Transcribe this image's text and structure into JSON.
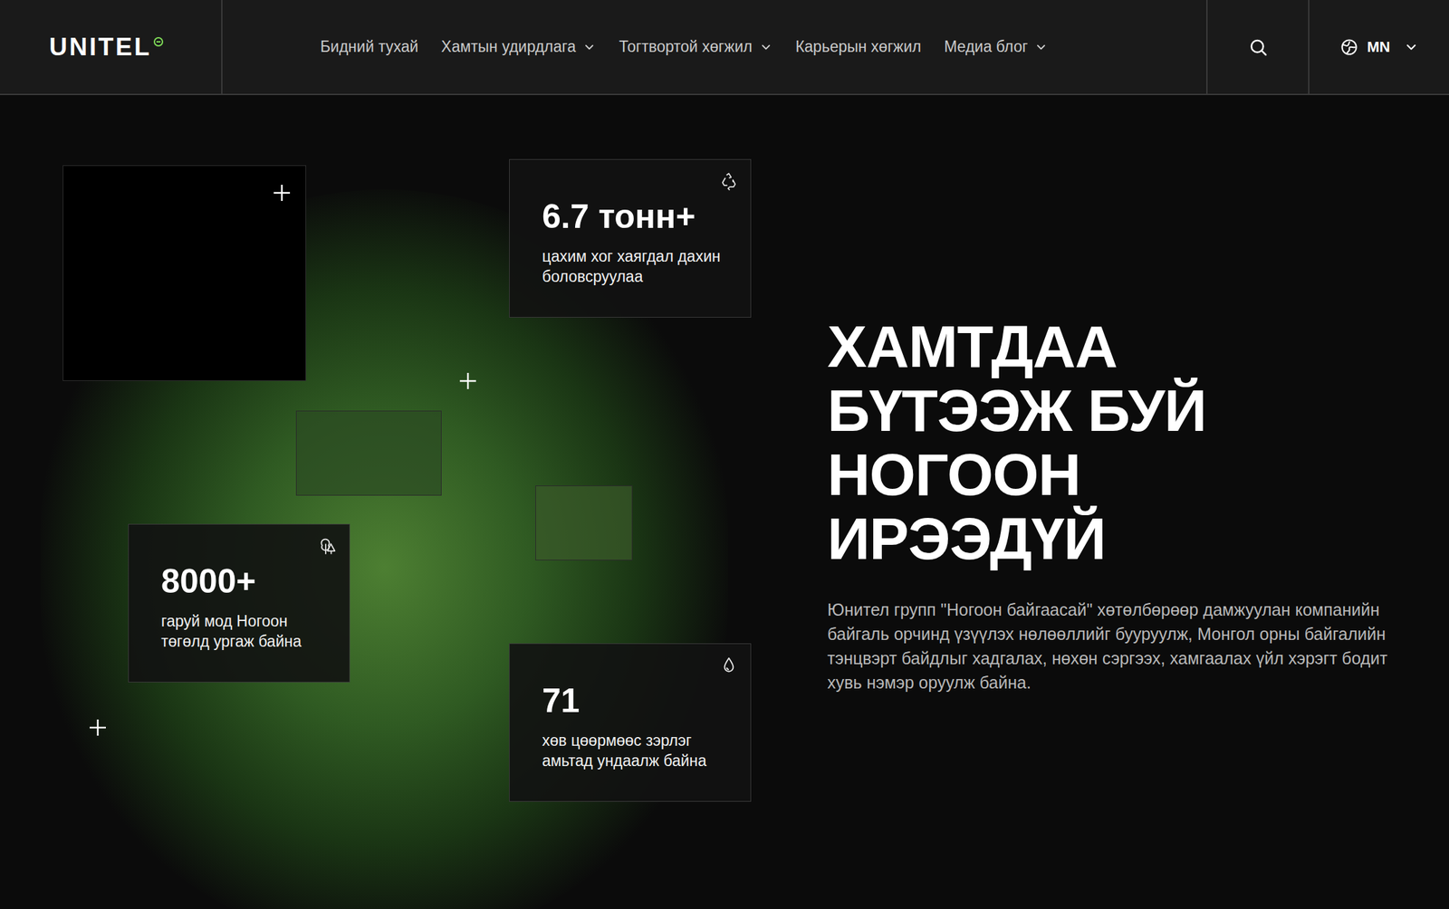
{
  "header": {
    "logo": "UNITEL",
    "language": "MN"
  },
  "nav": {
    "items": [
      {
        "label": "Бидний тухай",
        "dropdown": false
      },
      {
        "label": "Хамтын удирдлага",
        "dropdown": true
      },
      {
        "label": "Тогтвортой хөгжил",
        "dropdown": true
      },
      {
        "label": "Карьерын хөгжил",
        "dropdown": false
      },
      {
        "label": "Медиа блог",
        "dropdown": true
      }
    ]
  },
  "hero": {
    "title": [
      "ХАМТДАА",
      "БҮТЭЭЖ БУЙ",
      "НОГООН",
      "ИРЭЭДҮЙ"
    ],
    "description": "Юнител групп \"Ногоон байгаасай\" хөтөлбөрөөр дамжуулан компанийн байгаль орчинд үзүүлэх нөлөөллийг бууруулж, Монгол орны байгалийн тэнцвэрт байдлыг хадгалах, нөхөн сэргээх, хамгаалах үйл хэрэгт бодит хувь нэмэр оруулж байна."
  },
  "stats": [
    {
      "value": "6.7 тонн+",
      "label": "цахим хог хаягдал дахин боловсруулаа",
      "kind": "recycle"
    },
    {
      "value": "8000+",
      "label": "гаруй мод Ногоон төгөлд ургаж байна",
      "kind": "tree"
    },
    {
      "value": "71",
      "label": "хөв цөөрмөөс зэрлэг амьтад ундаалж байна",
      "kind": "water"
    }
  ]
}
